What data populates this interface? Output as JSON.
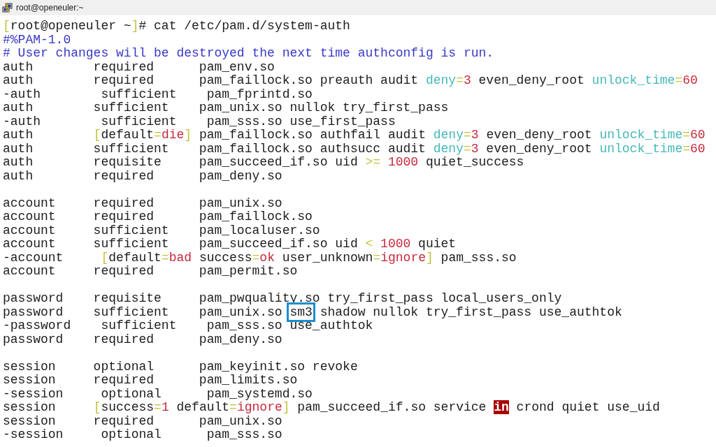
{
  "window": {
    "title": "root@openeuler:~"
  },
  "terminal": {
    "blocks": [
      {
        "lines": [
          [
            {
              "text": "[",
              "kind": "bracket"
            },
            {
              "text": "root@openeuler ~",
              "kind": "plain"
            },
            {
              "text": "]",
              "kind": "bracket"
            },
            {
              "text": "# cat /etc/pam.d/system-auth",
              "kind": "plain"
            }
          ],
          [
            {
              "text": "#%PAM-1.0",
              "kind": "comment"
            }
          ],
          [
            {
              "text": "# User changes will be destroyed the next time authconfig is run.",
              "kind": "comment"
            }
          ],
          [
            {
              "text": "auth        required      pam_env.so",
              "kind": "plain"
            }
          ],
          [
            {
              "text": "auth        required      pam_faillock.so preauth audit ",
              "kind": "plain"
            },
            {
              "text": "deny",
              "kind": "key"
            },
            {
              "text": "=",
              "kind": "bracket"
            },
            {
              "text": "3",
              "kind": "value"
            },
            {
              "text": " even_deny_root ",
              "kind": "plain"
            },
            {
              "text": "unlock_time",
              "kind": "key"
            },
            {
              "text": "=",
              "kind": "bracket"
            },
            {
              "text": "60",
              "kind": "value"
            }
          ],
          [
            {
              "text": "-auth        sufficient    pam_fprintd.so",
              "kind": "plain"
            }
          ],
          [
            {
              "text": "auth        sufficient    pam_unix.so nullok try_first_pass",
              "kind": "plain"
            }
          ],
          [
            {
              "text": "-auth        sufficient    pam_sss.so use_first_pass",
              "kind": "plain"
            }
          ],
          [
            {
              "text": "auth        ",
              "kind": "plain"
            },
            {
              "text": "[",
              "kind": "bracket"
            },
            {
              "text": "default",
              "kind": "plain"
            },
            {
              "text": "=",
              "kind": "bracket"
            },
            {
              "text": "die",
              "kind": "value"
            },
            {
              "text": "]",
              "kind": "bracket"
            },
            {
              "text": " pam_faillock.so authfail audit ",
              "kind": "plain"
            },
            {
              "text": "deny",
              "kind": "key"
            },
            {
              "text": "=",
              "kind": "bracket"
            },
            {
              "text": "3",
              "kind": "value"
            },
            {
              "text": " even_deny_root ",
              "kind": "plain"
            },
            {
              "text": "unlock_time",
              "kind": "key"
            },
            {
              "text": "=",
              "kind": "bracket"
            },
            {
              "text": "60",
              "kind": "value"
            }
          ],
          [
            {
              "text": "auth        sufficient    pam_faillock.so authsucc audit ",
              "kind": "plain"
            },
            {
              "text": "deny",
              "kind": "key"
            },
            {
              "text": "=",
              "kind": "bracket"
            },
            {
              "text": "3",
              "kind": "value"
            },
            {
              "text": " even_deny_root ",
              "kind": "plain"
            },
            {
              "text": "unlock_time",
              "kind": "key"
            },
            {
              "text": "=",
              "kind": "bracket"
            },
            {
              "text": "60",
              "kind": "value"
            }
          ],
          [
            {
              "text": "auth        requisite     pam_succeed_if.so uid ",
              "kind": "plain"
            },
            {
              "text": ">=",
              "kind": "bracket"
            },
            {
              "text": " 1000",
              "kind": "value"
            },
            {
              "text": " quiet_success",
              "kind": "plain"
            }
          ],
          [
            {
              "text": "auth        required      pam_deny.so",
              "kind": "plain"
            }
          ]
        ]
      },
      {
        "lines": [
          [
            {
              "text": "account     required      pam_unix.so",
              "kind": "plain"
            }
          ],
          [
            {
              "text": "account     required      pam_faillock.so",
              "kind": "plain"
            }
          ],
          [
            {
              "text": "account     sufficient    pam_localuser.so",
              "kind": "plain"
            }
          ],
          [
            {
              "text": "account     sufficient    pam_succeed_if.so uid ",
              "kind": "plain"
            },
            {
              "text": "<",
              "kind": "bracket"
            },
            {
              "text": " 1000",
              "kind": "value"
            },
            {
              "text": " quiet",
              "kind": "plain"
            }
          ],
          [
            {
              "text": "-account     ",
              "kind": "plain"
            },
            {
              "text": "[",
              "kind": "bracket"
            },
            {
              "text": "default",
              "kind": "plain"
            },
            {
              "text": "=",
              "kind": "bracket"
            },
            {
              "text": "bad",
              "kind": "value"
            },
            {
              "text": " success",
              "kind": "plain"
            },
            {
              "text": "=",
              "kind": "bracket"
            },
            {
              "text": "ok",
              "kind": "value"
            },
            {
              "text": " user_unknown",
              "kind": "plain"
            },
            {
              "text": "=",
              "kind": "bracket"
            },
            {
              "text": "ignore",
              "kind": "value"
            },
            {
              "text": "]",
              "kind": "bracket"
            },
            {
              "text": " pam_sss.so",
              "kind": "plain"
            }
          ],
          [
            {
              "text": "account     required      pam_permit.so",
              "kind": "plain"
            }
          ]
        ]
      },
      {
        "lines": [
          [
            {
              "text": "password    requisite     pam_pwquality.so try_first_pass local_users_only",
              "kind": "plain"
            }
          ],
          [
            {
              "text": "password    sufficient    pam_unix.so ",
              "kind": "plain"
            },
            {
              "text": "sm3",
              "kind": "marked"
            },
            {
              "text": " shadow nullok try_first_pass use_authtok",
              "kind": "plain"
            }
          ],
          [
            {
              "text": "-password    sufficient    pam_sss.so use_authtok",
              "kind": "plain"
            }
          ],
          [
            {
              "text": "password    required      pam_deny.so",
              "kind": "plain"
            }
          ]
        ]
      },
      {
        "lines": [
          [
            {
              "text": "session     optional      pam_keyinit.so revoke",
              "kind": "plain"
            }
          ],
          [
            {
              "text": "session     required      pam_limits.so",
              "kind": "plain"
            }
          ],
          [
            {
              "text": "-session     optional      pam_systemd.so",
              "kind": "plain"
            }
          ],
          [
            {
              "text": "session     ",
              "kind": "plain"
            },
            {
              "text": "[",
              "kind": "bracket"
            },
            {
              "text": "success",
              "kind": "plain"
            },
            {
              "text": "=",
              "kind": "bracket"
            },
            {
              "text": "1",
              "kind": "value"
            },
            {
              "text": " default",
              "kind": "plain"
            },
            {
              "text": "=",
              "kind": "bracket"
            },
            {
              "text": "ignore",
              "kind": "value"
            },
            {
              "text": "]",
              "kind": "bracket"
            },
            {
              "text": " pam_succeed_if.so service ",
              "kind": "plain"
            },
            {
              "text": "in",
              "kind": "flag"
            },
            {
              "text": " crond quiet use_uid",
              "kind": "plain"
            }
          ],
          [
            {
              "text": "session     required      pam_unix.so",
              "kind": "plain"
            }
          ],
          [
            {
              "text": "-session     optional      pam_sss.so",
              "kind": "plain"
            }
          ]
        ]
      }
    ]
  }
}
